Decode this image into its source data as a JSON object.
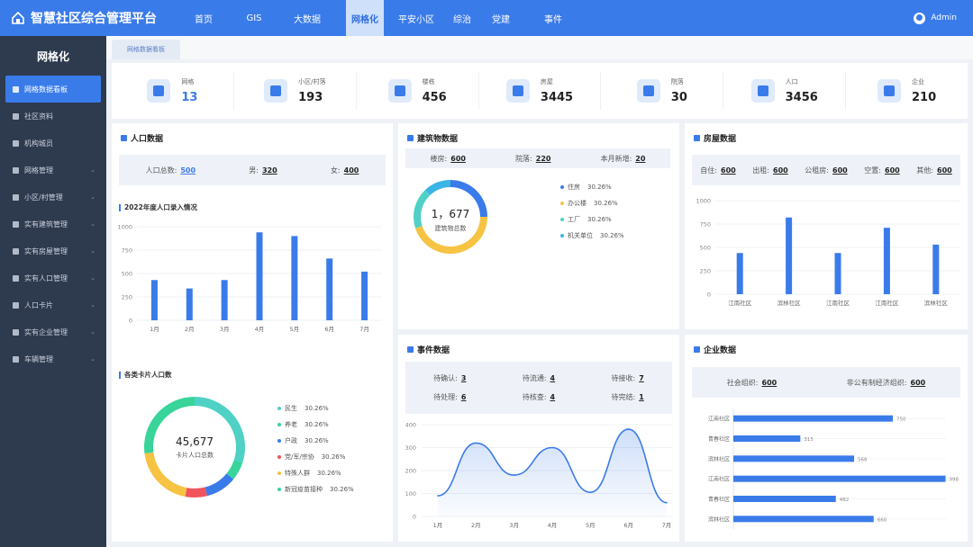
{
  "header": {
    "title": "智慧社区综合管理平台",
    "nav": [
      "首页",
      "GIS",
      "大数据",
      "网格化",
      "平安小区",
      "综治",
      "党建",
      "事件"
    ],
    "user": "Admin"
  },
  "sidebar": {
    "title": "网格化",
    "items": [
      "网格数据看板",
      "社区资料",
      "机构城员",
      "网格管理",
      "小区/村管理",
      "实有建筑管理",
      "实有房屋管理",
      "实有人口管理",
      "人口卡片",
      "实有企业管理",
      "车辆管理"
    ]
  },
  "tab": "网格数据看板",
  "stats": [
    {
      "label": "网格",
      "value": "13"
    },
    {
      "label": "小区/村落",
      "value": "193"
    },
    {
      "label": "楼栋",
      "value": "456"
    },
    {
      "label": "房屋",
      "value": "3445"
    },
    {
      "label": "院落",
      "value": "30"
    },
    {
      "label": "人口",
      "value": "3456"
    },
    {
      "label": "企业",
      "value": "210"
    }
  ],
  "population": {
    "title": "人口数据",
    "total_label": "人口总数:",
    "total": "500",
    "male_label": "男:",
    "male": "320",
    "female_label": "女:",
    "female": "400",
    "chart_title": "2022年度人口录入情况"
  },
  "card": {
    "title": "各类卡片人口数",
    "total": "45,677",
    "caption": "卡片人口总数",
    "legend": [
      {
        "name": "民生",
        "pct": "30.26%",
        "color": "#4fd1c5"
      },
      {
        "name": "养老",
        "pct": "30.26%",
        "color": "#38d49a"
      },
      {
        "name": "户政",
        "pct": "30.26%",
        "color": "#3a7bea"
      },
      {
        "name": "党/军/宗协",
        "pct": "30.26%",
        "color": "#f2545b"
      },
      {
        "name": "特殊人群",
        "pct": "30.26%",
        "color": "#f6c343"
      },
      {
        "name": "新冠疫苗接种",
        "pct": "30.26%",
        "color": "#38d49a"
      }
    ]
  },
  "building": {
    "title": "建筑物数据",
    "a_label": "楼房:",
    "a": "600",
    "b_label": "院落:",
    "b": "220",
    "c_label": "本月新增:",
    "c": "20",
    "total": "1，677",
    "caption": "建筑物总数",
    "legend": [
      {
        "name": "住房",
        "pct": "30.26%",
        "color": "#3a7bea"
      },
      {
        "name": "办公楼",
        "pct": "30.26%",
        "color": "#f6c343"
      },
      {
        "name": "工厂",
        "pct": "30.26%",
        "color": "#4fd1c5"
      },
      {
        "name": "机关单位",
        "pct": "30.26%",
        "color": "#3ab5e6"
      }
    ]
  },
  "house": {
    "title": "房屋数据",
    "items": [
      {
        "label": "自住:",
        "value": "600"
      },
      {
        "label": "出租:",
        "value": "600"
      },
      {
        "label": "公租房:",
        "value": "600"
      },
      {
        "label": "空置:",
        "value": "600"
      },
      {
        "label": "其他:",
        "value": "600"
      }
    ]
  },
  "events": {
    "title": "事件数据",
    "items": [
      {
        "label": "待确认:",
        "value": "3"
      },
      {
        "label": "待流通:",
        "value": "4"
      },
      {
        "label": "待接收:",
        "value": "7"
      },
      {
        "label": "待处理:",
        "value": "6"
      },
      {
        "label": "待核查:",
        "value": "4"
      },
      {
        "label": "待完结:",
        "value": "1"
      }
    ]
  },
  "enterprise": {
    "title": "企业数据",
    "a_label": "社会组织:",
    "a": "600",
    "b_label": "非公有制经济组织:",
    "b": "600"
  },
  "chart_data": [
    {
      "type": "bar",
      "title": "2022年度人口录入情况",
      "categories": [
        "1月",
        "2月",
        "3月",
        "4月",
        "5月",
        "6月",
        "7月"
      ],
      "values": [
        430,
        340,
        430,
        940,
        900,
        660,
        520
      ],
      "ylim": [
        0,
        1000
      ],
      "yticks": [
        0,
        250,
        500,
        750,
        1000
      ],
      "color": "#3a7bea"
    },
    {
      "type": "pie",
      "title": "各类卡片人口数",
      "categories": [
        "民生",
        "养老",
        "户政",
        "党/军/宗协",
        "特殊人群",
        "新冠疫苗接种"
      ],
      "values": [
        30,
        6,
        10,
        7,
        20,
        27
      ],
      "colors": [
        "#4fd1c5",
        "#38d49a",
        "#3a7bea",
        "#f2545b",
        "#f6c343",
        "#38d49a"
      ]
    },
    {
      "type": "pie",
      "title": "建筑物数据",
      "categories": [
        "住房",
        "办公楼",
        "工厂",
        "机关单位"
      ],
      "values": [
        25,
        45,
        18,
        12
      ],
      "colors": [
        "#3a7bea",
        "#f6c343",
        "#4fd1c5",
        "#3ab5e6"
      ]
    },
    {
      "type": "bar",
      "title": "房屋数据",
      "categories": [
        "江南社区",
        "滨林社区",
        "江南社区",
        "江南社区",
        "滨林社区"
      ],
      "values": [
        440,
        820,
        440,
        710,
        530
      ],
      "ylim": [
        0,
        1000
      ],
      "yticks": [
        0,
        250,
        500,
        750,
        1000
      ],
      "color": "#3a7bea"
    },
    {
      "type": "line",
      "title": "事件数据",
      "categories": [
        "1月",
        "2月",
        "3月",
        "4月",
        "5月",
        "6月",
        "7月"
      ],
      "values": [
        90,
        320,
        180,
        300,
        105,
        380,
        60
      ],
      "ylim": [
        0,
        400
      ],
      "yticks": [
        0,
        100,
        200,
        300,
        400
      ],
      "color": "#3a7bea"
    },
    {
      "type": "bar",
      "orientation": "horizontal",
      "title": "企业数据",
      "categories": [
        "江南社区",
        "青春社区",
        "滨林社区",
        "江南社区",
        "青春社区",
        "滨林社区"
      ],
      "values": [
        750,
        315,
        568,
        998,
        482,
        660
      ],
      "xlim": [
        0,
        1000
      ],
      "color": "#3a7bea"
    }
  ]
}
